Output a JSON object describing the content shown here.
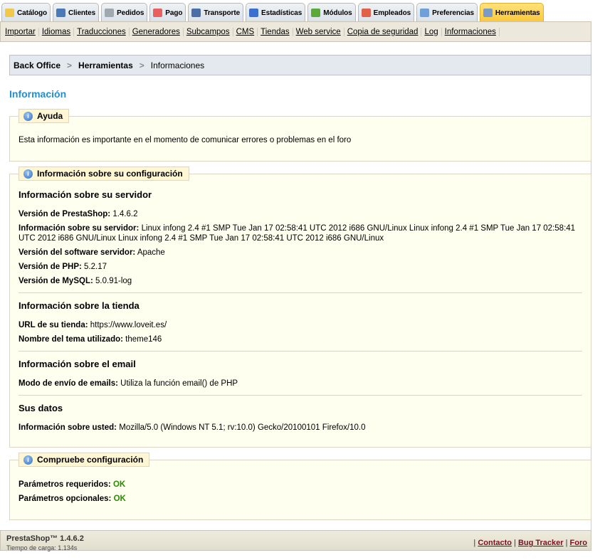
{
  "tabs": [
    {
      "label": "Catálogo",
      "icon": "folder-icon",
      "color": "#f1c94a"
    },
    {
      "label": "Clientes",
      "icon": "user-icon",
      "color": "#4b79b8"
    },
    {
      "label": "Pedidos",
      "icon": "cart-icon",
      "color": "#a0a8b0"
    },
    {
      "label": "Pago",
      "icon": "payment-icon",
      "color": "#e86060"
    },
    {
      "label": "Transporte",
      "icon": "truck-icon",
      "color": "#4a6fa8"
    },
    {
      "label": "Estadísticas",
      "icon": "bar-chart-icon",
      "color": "#3a6fcf"
    },
    {
      "label": "Módulos",
      "icon": "puzzle-icon",
      "color": "#5aaa3a"
    },
    {
      "label": "Empleados",
      "icon": "employee-icon",
      "color": "#e0604a"
    },
    {
      "label": "Preferencias",
      "icon": "preferences-icon",
      "color": "#6fa0d8"
    },
    {
      "label": "Herramientas",
      "icon": "wrench-icon",
      "color": "#7a9ac8"
    }
  ],
  "submenu": [
    "Importar",
    "Idiomas",
    "Traducciones",
    "Generadores",
    "Subcampos",
    "CMS",
    "Tiendas",
    "Web service",
    "Copia de seguridad",
    "Log",
    "Informaciones"
  ],
  "breadcrumb": [
    "Back Office",
    "Herramientas",
    "Informaciones"
  ],
  "title": "Información",
  "help": {
    "legend": "Ayuda",
    "text": "Esta información es importante en el momento de comunicar errores o problemas en el foro"
  },
  "config": {
    "legend": "Información sobre su configuración",
    "server": {
      "title": "Información sobre su servidor",
      "rows": [
        {
          "k": "Versión de PrestaShop:",
          "v": "1.4.6.2"
        },
        {
          "k": "Información sobre su servidor:",
          "v": "Linux infong 2.4 #1 SMP Tue Jan 17 02:58:41 UTC 2012 i686 GNU/Linux Linux infong 2.4 #1 SMP Tue Jan 17 02:58:41 UTC 2012 i686 GNU/Linux Linux infong 2.4 #1 SMP Tue Jan 17 02:58:41 UTC 2012 i686 GNU/Linux"
        },
        {
          "k": "Versión del software servidor:",
          "v": "Apache"
        },
        {
          "k": "Versión de PHP:",
          "v": "5.2.17"
        },
        {
          "k": "Versión de MySQL:",
          "v": "5.0.91-log"
        }
      ]
    },
    "shop": {
      "title": "Información sobre la tienda",
      "rows": [
        {
          "k": "URL de su tienda:",
          "v": "https://www.loveit.es/"
        },
        {
          "k": "Nombre del tema utilizado:",
          "v": "theme146"
        }
      ]
    },
    "email": {
      "title": "Información sobre el email",
      "rows": [
        {
          "k": "Modo de envío de emails:",
          "v": "Utiliza la función email() de PHP"
        }
      ]
    },
    "you": {
      "title": "Sus datos",
      "rows": [
        {
          "k": "Información sobre usted:",
          "v": "Mozilla/5.0 (Windows NT 5.1; rv:10.0) Gecko/20100101 Firefox/10.0"
        }
      ]
    }
  },
  "check": {
    "legend": "Compruebe configuración",
    "rows": [
      {
        "k": "Parámetros requeridos:",
        "v": "OK"
      },
      {
        "k": "Parámetros opcionales:",
        "v": "OK"
      }
    ]
  },
  "footer": {
    "version": "PrestaShop™ 1.4.6.2",
    "load": "Tiempo de carga: 1.134s",
    "links": [
      "Contacto",
      "Bug Tracker",
      "Foro"
    ]
  }
}
